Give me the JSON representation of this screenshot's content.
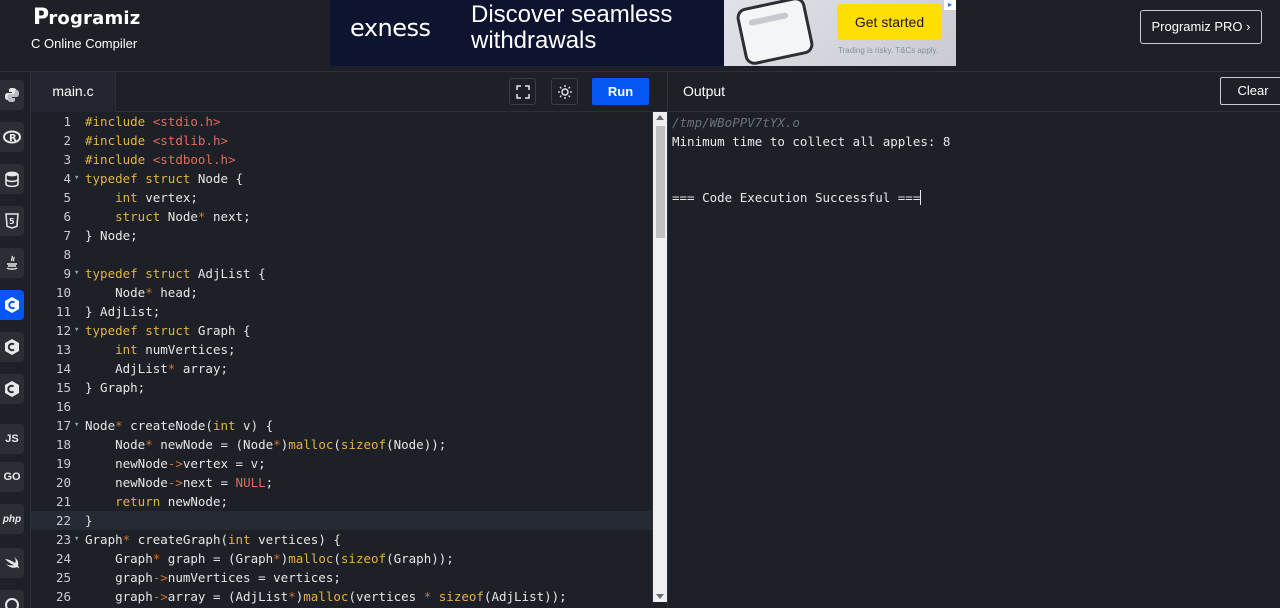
{
  "header": {
    "logo_text": "rogramiz",
    "logo_mark": "P",
    "subtitle": "C Online Compiler",
    "pro_button": "Programiz PRO ›"
  },
  "ad": {
    "brand": "exness",
    "headline": "Discover seamless withdrawals",
    "cta": "Get started",
    "disclaimer": "Trading is risky. T&Cs apply.",
    "accent_color": "#ffde02"
  },
  "rail": {
    "items": [
      {
        "name": "python",
        "label": "",
        "icon": "python-icon"
      },
      {
        "name": "r",
        "label": "R",
        "icon": "r-icon"
      },
      {
        "name": "sql",
        "label": "",
        "icon": "database-icon"
      },
      {
        "name": "html",
        "label": "5",
        "icon": "html5-icon"
      },
      {
        "name": "java",
        "label": "",
        "icon": "java-icon"
      },
      {
        "name": "c",
        "label": "C",
        "icon": "c-icon",
        "active": true
      },
      {
        "name": "cpp",
        "label": "C",
        "icon": "cpp-icon"
      },
      {
        "name": "csharp",
        "label": "C",
        "icon": "csharp-icon"
      },
      {
        "name": "js",
        "label": "JS",
        "icon": "javascript-icon"
      },
      {
        "name": "go",
        "label": "GO",
        "icon": "go-icon"
      },
      {
        "name": "php",
        "label": "php",
        "icon": "php-icon"
      },
      {
        "name": "swift",
        "label": "",
        "icon": "swift-icon"
      },
      {
        "name": "rust",
        "label": "",
        "icon": "rust-icon"
      }
    ]
  },
  "editor": {
    "file_name": "main.c",
    "run_label": "Run",
    "highlight_line": 22,
    "lines": [
      {
        "n": "1",
        "code": "#include <stdio.h>"
      },
      {
        "n": "2",
        "code": "#include <stdlib.h>"
      },
      {
        "n": "3",
        "code": "#include <stdbool.h>"
      },
      {
        "n": "4",
        "code": "typedef struct Node {",
        "fold": true
      },
      {
        "n": "5",
        "code": "    int vertex;"
      },
      {
        "n": "6",
        "code": "    struct Node* next;"
      },
      {
        "n": "7",
        "code": "} Node;"
      },
      {
        "n": "8",
        "code": ""
      },
      {
        "n": "9",
        "code": "typedef struct AdjList {",
        "fold": true
      },
      {
        "n": "10",
        "code": "    Node* head;"
      },
      {
        "n": "11",
        "code": "} AdjList;"
      },
      {
        "n": "12",
        "code": "typedef struct Graph {",
        "fold": true
      },
      {
        "n": "13",
        "code": "    int numVertices;"
      },
      {
        "n": "14",
        "code": "    AdjList* array;"
      },
      {
        "n": "15",
        "code": "} Graph;"
      },
      {
        "n": "16",
        "code": ""
      },
      {
        "n": "17",
        "code": "Node* createNode(int v) {",
        "fold": true
      },
      {
        "n": "18",
        "code": "    Node* newNode = (Node*)malloc(sizeof(Node));"
      },
      {
        "n": "19",
        "code": "    newNode->vertex = v;"
      },
      {
        "n": "20",
        "code": "    newNode->next = NULL;"
      },
      {
        "n": "21",
        "code": "    return newNode;"
      },
      {
        "n": "22",
        "code": "}"
      },
      {
        "n": "23",
        "code": "Graph* createGraph(int vertices) {",
        "fold": true
      },
      {
        "n": "24",
        "code": "    Graph* graph = (Graph*)malloc(sizeof(Graph));"
      },
      {
        "n": "25",
        "code": "    graph->numVertices = vertices;"
      },
      {
        "n": "26",
        "code": "    graph->array = (AdjList*)malloc(vertices * sizeof(AdjList));"
      }
    ]
  },
  "output": {
    "title": "Output",
    "clear_label": "Clear",
    "path": "/tmp/WBoPPV7tYX.o",
    "result": "Minimum time to collect all apples: 8",
    "status": "=== Code Execution Successful ==="
  }
}
